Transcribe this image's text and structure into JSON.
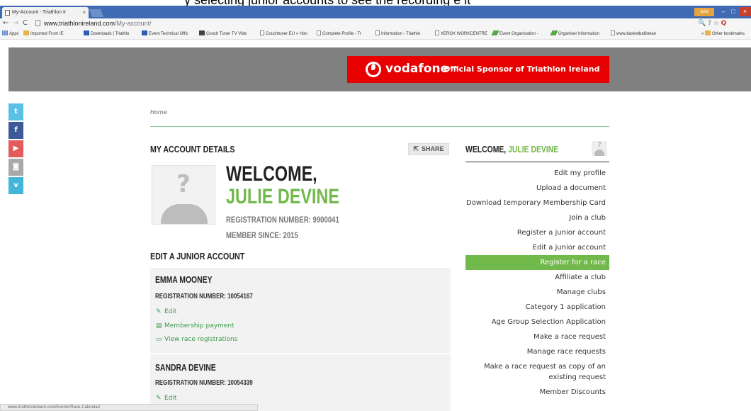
{
  "caption": "y selecting junior accounts to see the recording e it",
  "browser": {
    "tab_title": "My-Account - Triathlon Ir",
    "tab_close": "×",
    "user_badge": "Julie",
    "win_min": "–",
    "win_max": "□",
    "win_close": "×",
    "url_host": "www.triathlonireland.com",
    "url_path": "/My-account/",
    "back": "←",
    "forward": "→",
    "reload": "C",
    "ext_icons": "🔍 ? ☆",
    "ext_icon_red": "Q",
    "bookmarks": [
      {
        "label": "Apps",
        "icon": "grid"
      },
      {
        "label": "Imported From IE",
        "icon": "folder"
      },
      {
        "label": "Downloads | Triathlo",
        "icon": "blue"
      },
      {
        "label": "Event Technical Offic",
        "icon": "blue"
      },
      {
        "label": "Couch Tuner TV Vide",
        "icon": "tv"
      },
      {
        "label": "Couchtuner EU » Hon",
        "icon": "page"
      },
      {
        "label": "Complete Profile - Tr",
        "icon": "page"
      },
      {
        "label": "Information - Triathlo",
        "icon": "page"
      },
      {
        "label": "XEROX WORKCENTRE",
        "icon": "page"
      },
      {
        "label": "Event Organisation -",
        "icon": "green"
      },
      {
        "label": "Organiser Information",
        "icon": "green"
      },
      {
        "label": "www.basketballirelan",
        "icon": "page"
      }
    ],
    "bookmarks_more": "»",
    "other_bookmarks": "Other bookmarks",
    "status_url": "www.triathlonireland.com/Events/Race-Calendar/"
  },
  "sponsor": {
    "brand": "vodafone",
    "text": "Official Sponsor of Triathlon Ireland"
  },
  "social": {
    "twitter": "t",
    "facebook": "f",
    "youtube": "▶",
    "instagram": "◙",
    "vimeo": "v"
  },
  "breadcrumb": "Home",
  "account": {
    "heading": "MY ACCOUNT DETAILS",
    "share_label": "SHARE",
    "share_icon": "⇱",
    "welcome_line1": "WELCOME,",
    "welcome_name": "JULIE DEVINE",
    "registration": "REGISTRATION NUMBER: 9900041",
    "member_since": "MEMBER SINCE: 2015",
    "avatar_glyph": "?"
  },
  "junior": {
    "heading": "EDIT A JUNIOR ACCOUNT",
    "accounts": [
      {
        "name": "EMMA MOONEY",
        "registration": "REGISTRATION NUMBER: 10054167",
        "edit": "Edit",
        "membership": "Membership payment",
        "race_regs": "View race registrations"
      },
      {
        "name": "SANDRA DEVINE",
        "registration": "REGISTRATION NUMBER: 10054339",
        "edit": "Edit"
      }
    ],
    "icons": {
      "edit": "✎",
      "membership": "▤",
      "races": "▭"
    }
  },
  "sidebar": {
    "welcome_prefix": "WELCOME, ",
    "welcome_user": "JULIE DEVINE",
    "avatar_glyph": "?",
    "menu": [
      "Edit my profile",
      "Upload a document",
      "Download temporary Membership Card",
      "Join a club",
      "Register a junior account",
      "Edit a junior account",
      "Register for a race",
      "Affiliate a club",
      "Manage clubs",
      "Category 1 application",
      "Age Group Selection Application",
      "Make a race request",
      "Manage race requests",
      "Make a race request as copy of an existing request",
      "Member Discounts"
    ],
    "active_index": 6
  }
}
